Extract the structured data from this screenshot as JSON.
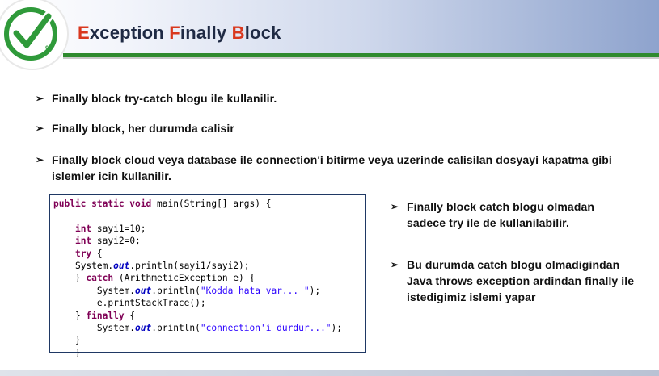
{
  "header": {
    "title_parts": [
      {
        "cap": "E",
        "rest": "xception "
      },
      {
        "cap": "F",
        "rest": "inally "
      },
      {
        "cap": "B",
        "rest": "lock"
      }
    ],
    "logo_icon": "checkmark-logo-icon",
    "logo_text": "01"
  },
  "bullets": [
    {
      "icon": "arrow-bullet-icon",
      "arrow": "➢",
      "text": "Finally block try-catch blogu ile kullanilir."
    },
    {
      "icon": "arrow-bullet-icon",
      "arrow": "➢",
      "text": "Finally block, her durumda calisir"
    },
    {
      "icon": "arrow-bullet-icon",
      "arrow": "➢",
      "text": "Finally block cloud veya database ile connection'i bitirme veya uzerinde calisilan dosyayi kapatma gibi islemler icin kullanilir."
    }
  ],
  "side_bullets": [
    {
      "arrow": "➢",
      "text": "Finally block catch blogu olmadan sadece try ile de kullanilabilir."
    },
    {
      "arrow": "➢",
      "text": "Bu durumda catch blogu olmadigindan Java throws exception ardindan finally ile istedigimiz islemi yapar"
    }
  ],
  "code": {
    "line1": {
      "kw": "public static void",
      "rest": " main(String[] args) {"
    },
    "line2": "",
    "line3": {
      "indent": "    ",
      "kw": "int",
      "rest": " sayi1=10;"
    },
    "line4": {
      "indent": "    ",
      "kw": "int",
      "rest": " sayi2=0;"
    },
    "line5": {
      "indent": "    ",
      "kw": "try",
      "rest": " {"
    },
    "line6": {
      "indent": "    ",
      "pre": "System.",
      "it": "out",
      "rest": ".println(sayi1/sayi2);"
    },
    "line7": {
      "indent": "    } ",
      "kw": "catch",
      "rest": " (ArithmeticException e) {"
    },
    "line8": {
      "indent": "        ",
      "pre": "System.",
      "it": "out",
      "mid": ".println(",
      "str": "\"Kodda hata var... \"",
      "rest": ");"
    },
    "line9": {
      "indent": "        ",
      "rest": "e.printStackTrace();"
    },
    "line10": {
      "indent": "    } ",
      "kw": "finally",
      "rest": " {"
    },
    "line11": {
      "indent": "        ",
      "pre": "System.",
      "it": "out",
      "mid": ".println(",
      "str": "\"connection'i durdur...\"",
      "rest": ");"
    },
    "line12": {
      "indent": "    ",
      "rest": "}"
    },
    "line13": {
      "indent": "    ",
      "rest": "}"
    }
  },
  "colors": {
    "title_cap": "#d9381e",
    "title_text": "#1f2a44",
    "header_rule": "#2f8a2e",
    "code_border": "#1f3864",
    "keyword": "#7f0055",
    "field": "#0000c0",
    "string": "#2a00ff"
  }
}
